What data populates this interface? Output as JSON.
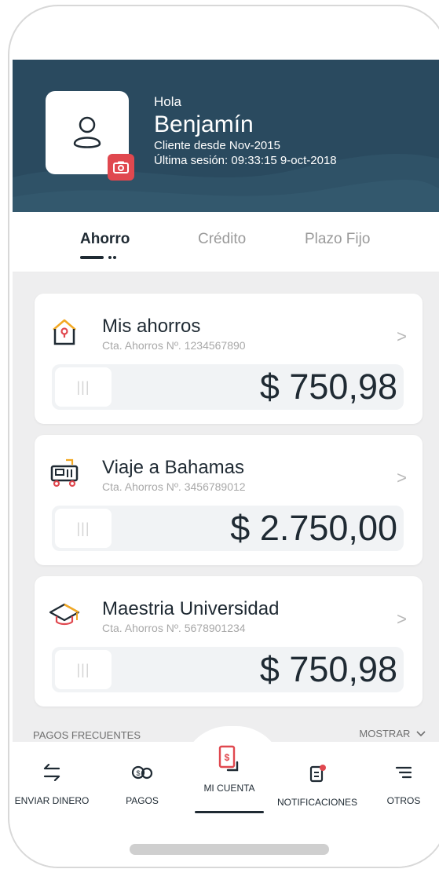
{
  "header": {
    "greeting": "Hola",
    "name": "Benjamín",
    "client_since": "Cliente desde Nov-2015",
    "last_session": "Última sesión: 09:33:15 9-oct-2018"
  },
  "tabs": [
    {
      "label": "Ahorro",
      "active": true
    },
    {
      "label": "Crédito",
      "active": false
    },
    {
      "label": "Plazo Fijo",
      "active": false
    }
  ],
  "accounts": [
    {
      "title": "Mis ahorros",
      "subtitle": "Cta. Ahorros Nº. 1234567890",
      "amount": "$ 750,98",
      "icon": "house-icon"
    },
    {
      "title": "Viaje a Bahamas",
      "subtitle": "Cta. Ahorros Nº. 3456789012",
      "amount": "$ 2.750,00",
      "icon": "luggage-icon"
    },
    {
      "title": "Maestria Universidad",
      "subtitle": "Cta. Ahorros Nº. 5678901234",
      "amount": "$ 750,98",
      "icon": "graduation-cap-icon"
    }
  ],
  "slider_handle": "|||",
  "chevron": ">",
  "bottom": {
    "frequent_payments": "PAGOS FRECUENTES",
    "show": "MOSTRAR",
    "nav": [
      {
        "label": "ENVIAR DINERO",
        "icon": "transfer-arrows-icon"
      },
      {
        "label": "PAGOS",
        "icon": "coins-icon"
      },
      {
        "label": "MI CUENTA",
        "icon": "account-phone-icon",
        "active": true
      },
      {
        "label": "NOTIFICACIONES",
        "icon": "notifications-icon"
      },
      {
        "label": "OTROS",
        "icon": "menu-lines-icon"
      }
    ]
  },
  "colors": {
    "header": "#2a4a5f",
    "accent_red": "#e0484f",
    "text_dark": "#1f2a33",
    "background": "#eeeeef"
  }
}
